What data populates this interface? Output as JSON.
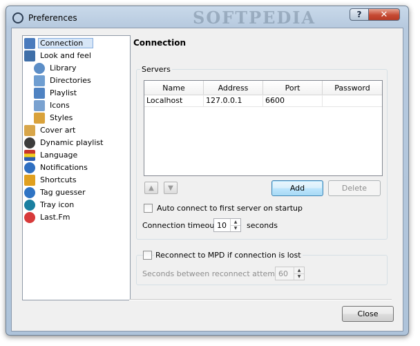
{
  "window": {
    "title": "Preferences",
    "watermark": "SOFTPEDIA"
  },
  "titlebar": {
    "help": "?",
    "close": "✕"
  },
  "sidebar": {
    "items": [
      {
        "label": "Connection",
        "icon": "connection-icon",
        "color": "#4a7bbd"
      },
      {
        "label": "Look and feel",
        "icon": "look-and-feel-icon",
        "color": "#3f6fa8"
      },
      {
        "label": "Library",
        "icon": "library-icon",
        "color": "#5c8ec7"
      },
      {
        "label": "Directories",
        "icon": "directories-icon",
        "color": "#6f9ed1"
      },
      {
        "label": "Playlist",
        "icon": "playlist-icon",
        "color": "#4f83c2"
      },
      {
        "label": "Icons",
        "icon": "icons-icon",
        "color": "#7aa2d0"
      },
      {
        "label": "Styles",
        "icon": "styles-icon",
        "color": "#d9a23b"
      },
      {
        "label": "Cover art",
        "icon": "cover-art-icon",
        "color": "#d8a64a"
      },
      {
        "label": "Dynamic playlist",
        "icon": "gear-icon",
        "color": "#3c3c3c"
      },
      {
        "label": "Language",
        "icon": "flag-icon",
        "color": "#c8352a"
      },
      {
        "label": "Notifications",
        "icon": "info-icon",
        "color": "#2f6fc1"
      },
      {
        "label": "Shortcuts",
        "icon": "shortcuts-icon",
        "color": "#e0a020"
      },
      {
        "label": "Tag guesser",
        "icon": "help-icon",
        "color": "#2f74c4"
      },
      {
        "label": "Tray icon",
        "icon": "tray-icon",
        "color": "#1a7fa0"
      },
      {
        "label": "Last.Fm",
        "icon": "lastfm-icon",
        "color": "#d73a3a"
      }
    ]
  },
  "page": {
    "title": "Connection"
  },
  "servers": {
    "group_title": "Servers",
    "columns": [
      "Name",
      "Address",
      "Port",
      "Password"
    ],
    "rows": [
      [
        "Localhost",
        "127.0.0.1",
        "6600",
        ""
      ]
    ],
    "add_label": "Add",
    "delete_label": "Delete",
    "auto_connect_label": "Auto connect to first server on startup",
    "auto_connect_checked": false,
    "timeout_label": "Connection timeout:",
    "timeout_value": "10",
    "timeout_unit": "seconds"
  },
  "reconnect": {
    "label": "Reconnect to MPD if connection is lost",
    "checked": false,
    "attempts_label": "Seconds between reconnect attempts:",
    "attempts_value": "60"
  },
  "footer": {
    "close_label": "Close"
  }
}
